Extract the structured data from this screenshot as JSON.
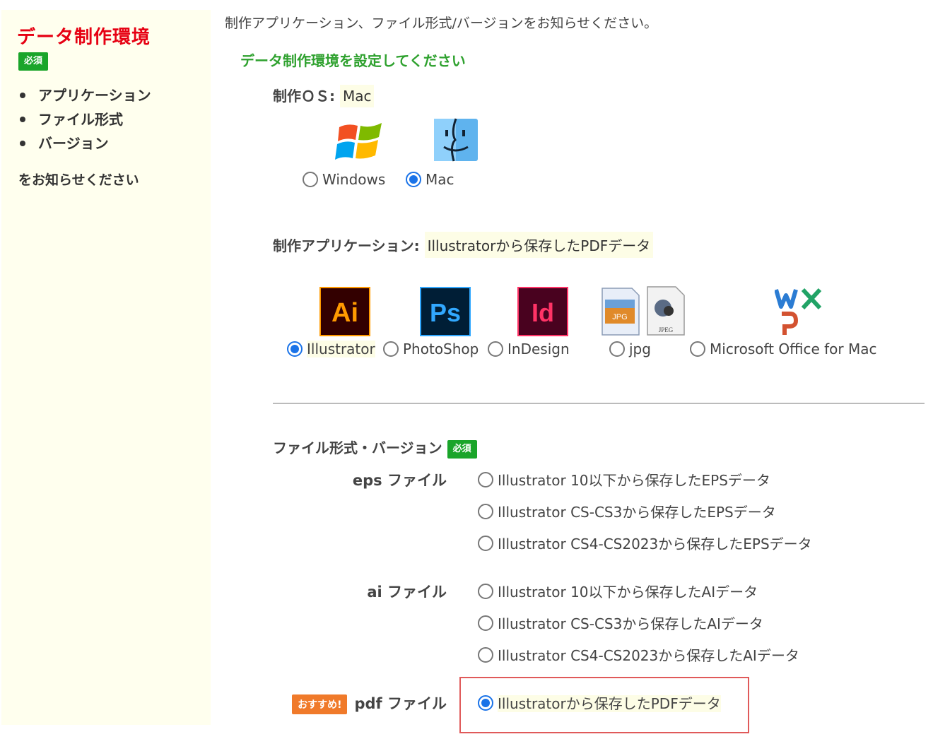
{
  "sidebar": {
    "title": "データ制作環境",
    "required_badge": "必須",
    "items": [
      "アプリケーション",
      "ファイル形式",
      "バージョン"
    ],
    "note": "をお知らせください"
  },
  "main": {
    "intro": "制作アプリケーション、ファイル形式/バージョンをお知らせください。",
    "subhead": "データ制作環境を設定してください",
    "os": {
      "label": "制作ＯＳ:",
      "selected": "Mac",
      "options": [
        {
          "label": "Windows",
          "icon": "windows-logo-icon",
          "checked": false
        },
        {
          "label": "Mac",
          "icon": "mac-finder-icon",
          "checked": true
        }
      ]
    },
    "app": {
      "label": "制作アプリケーション:",
      "selected": "Illustratorから保存したPDFデータ",
      "options": [
        {
          "label": "Illustrator",
          "icon": "illustrator-icon",
          "icon_text": "Ai",
          "color": "#ff9a00",
          "checked": true
        },
        {
          "label": "PhotoShop",
          "icon": "photoshop-icon",
          "icon_text": "Ps",
          "color": "#31a8ff",
          "checked": false
        },
        {
          "label": "InDesign",
          "icon": "indesign-icon",
          "icon_text": "Id",
          "color": "#ff3366",
          "checked": false
        },
        {
          "label": "jpg",
          "icon": "jpg-file-icon",
          "icon_text": "JPG",
          "icon_text2": "JPEG",
          "checked": false
        },
        {
          "label": "Microsoft Office for Mac",
          "icon": "ms-office-icon",
          "checked": false
        }
      ]
    },
    "format": {
      "label": "ファイル形式・バージョン",
      "required_badge": "必須",
      "groups": [
        {
          "label": "eps ファイル",
          "options": [
            {
              "label": "Illustrator 10以下から保存したEPSデータ",
              "checked": false
            },
            {
              "label": "Illustrator CS-CS3から保存したEPSデータ",
              "checked": false
            },
            {
              "label": "Illustrator CS4-CS2023から保存したEPSデータ",
              "checked": false
            }
          ]
        },
        {
          "label": "ai ファイル",
          "options": [
            {
              "label": "Illustrator 10以下から保存したAIデータ",
              "checked": false
            },
            {
              "label": "Illustrator CS-CS3から保存したAIデータ",
              "checked": false
            },
            {
              "label": "Illustrator CS4-CS2023から保存したAIデータ",
              "checked": false
            }
          ]
        },
        {
          "label": "pdf ファイル",
          "recommend_badge": "おすすめ!",
          "options": [
            {
              "label": "Illustratorから保存したPDFデータ",
              "checked": true
            }
          ]
        }
      ]
    }
  },
  "colors": {
    "sidebar_bg": "#ffffee",
    "title_red": "#e60012",
    "badge_green": "#1aa52a",
    "subhead_green": "#2ea12e",
    "radio_blue": "#1a73e8",
    "recommend_orange": "#f07a2a",
    "highlight_border": "#e05a5a"
  }
}
